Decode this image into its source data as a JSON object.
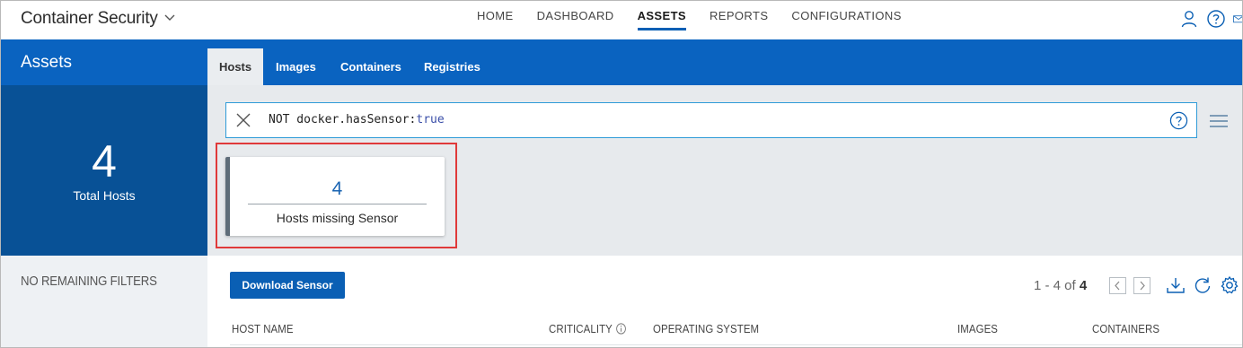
{
  "app": {
    "title": "Container Security"
  },
  "nav": {
    "items": [
      {
        "label": "HOME",
        "active": false
      },
      {
        "label": "DASHBOARD",
        "active": false
      },
      {
        "label": "ASSETS",
        "active": true
      },
      {
        "label": "REPORTS",
        "active": false
      },
      {
        "label": "CONFIGURATIONS",
        "active": false
      }
    ]
  },
  "topicons": [
    "user-icon",
    "help-icon",
    "mail-icon"
  ],
  "sidebar": {
    "title": "Assets",
    "total_count": "4",
    "total_label": "Total Hosts",
    "filters_text": "NO REMAINING FILTERS"
  },
  "tabs": [
    {
      "label": "Hosts",
      "active": true
    },
    {
      "label": "Images",
      "active": false
    },
    {
      "label": "Containers",
      "active": false
    },
    {
      "label": "Registries",
      "active": false
    }
  ],
  "search": {
    "query_key": "NOT docker.hasSensor:",
    "query_value": "true"
  },
  "card": {
    "count": "4",
    "label": "Hosts missing Sensor"
  },
  "toolbar": {
    "download_label": "Download Sensor",
    "paging_range": "1 - 4 of ",
    "paging_total": "4"
  },
  "table": {
    "columns": [
      "HOST NAME",
      "CRITICALITY",
      "OPERATING SYSTEM",
      "IMAGES",
      "CONTAINERS"
    ]
  },
  "colors": {
    "brand_blue": "#0a63c0",
    "dark_blue": "#085196",
    "highlight_red": "#e03a3a",
    "query_value": "#3a4ea8"
  }
}
